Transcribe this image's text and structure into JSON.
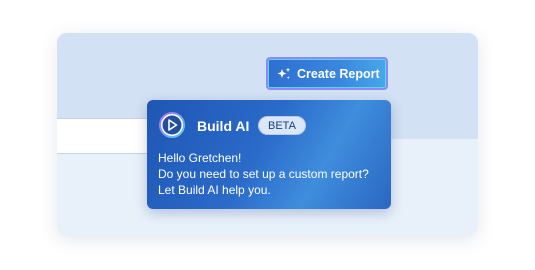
{
  "toolbar": {
    "create_report_label": "Create Report",
    "create_report_icon": "sparkle-icon"
  },
  "assistant": {
    "name": "Build AI",
    "badge": "BETA",
    "logo_icon": "build-ai-play-logo-icon",
    "message_lines": [
      "Hello Gretchen!",
      "Do you need to set up a custom report?",
      "Let Build AI help you."
    ]
  },
  "colors": {
    "popover_blue": "#2a6ac9",
    "button_blue": "#3a86df",
    "button_border": "#8e8af5",
    "panel_light": "#d2e1f3"
  }
}
